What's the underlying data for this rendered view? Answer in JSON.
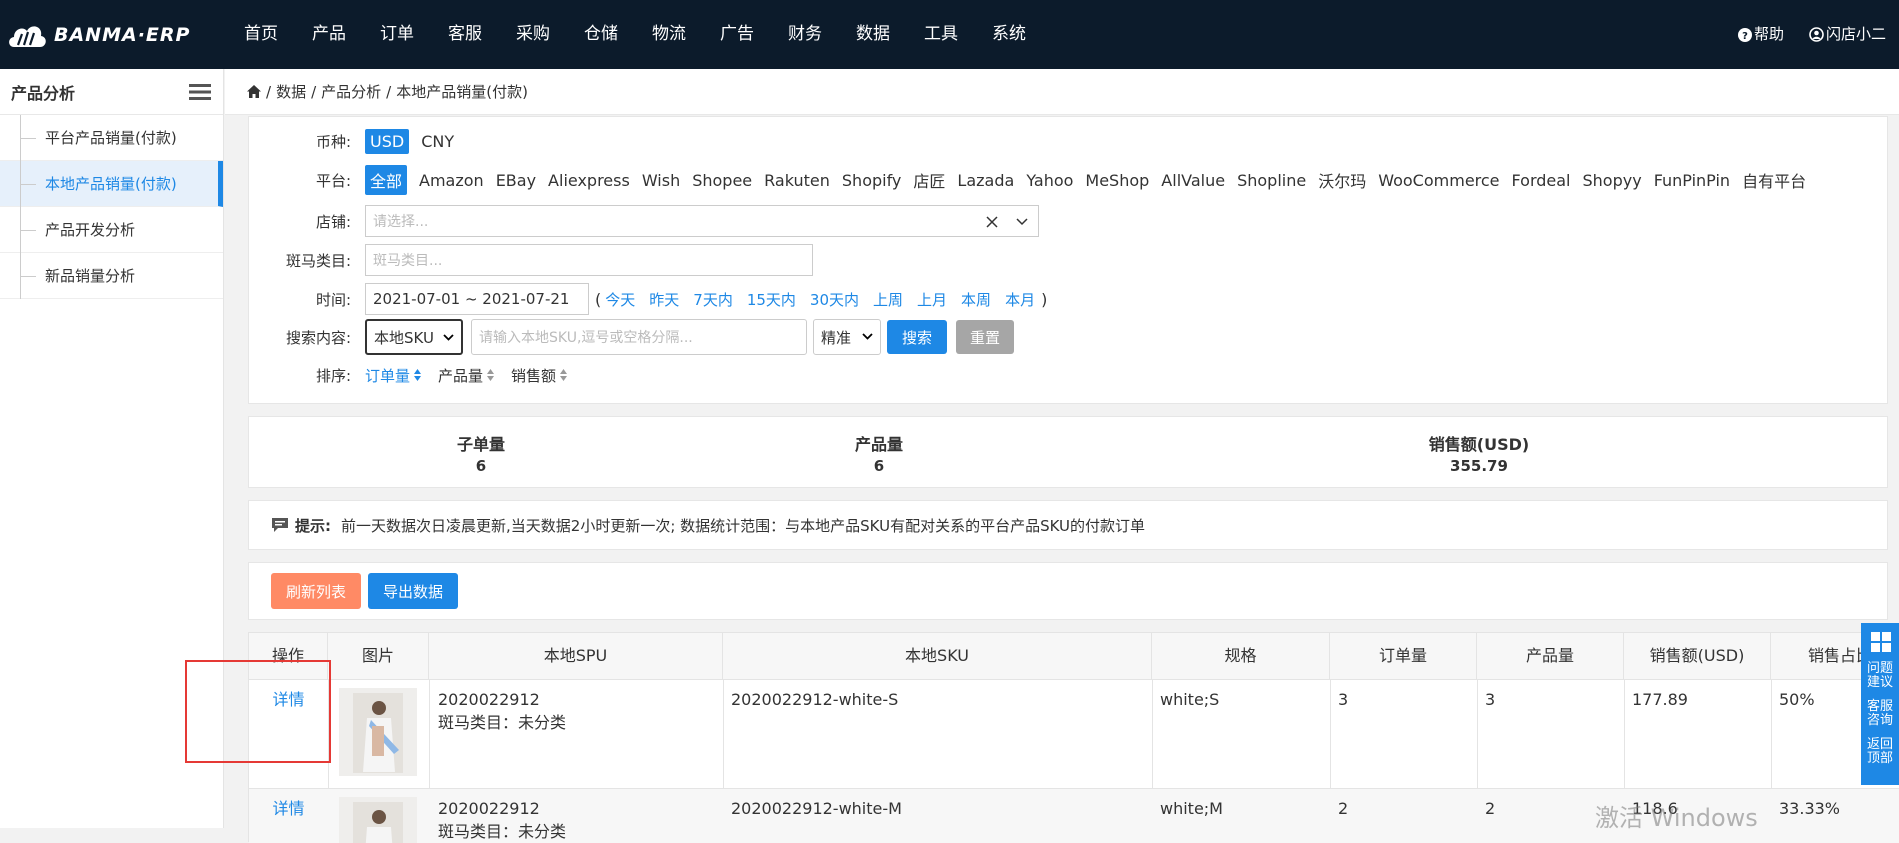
{
  "app": {
    "logo": "BANMA·ERP"
  },
  "nav": [
    "首页",
    "产品",
    "订单",
    "客服",
    "采购",
    "仓储",
    "物流",
    "广告",
    "财务",
    "数据",
    "工具",
    "系统"
  ],
  "top_right": {
    "help": "帮助",
    "user": "闪店小二"
  },
  "sidebar": {
    "title": "产品分析",
    "items": [
      {
        "label": "平台产品销量(付款)"
      },
      {
        "label": "本地产品销量(付款)"
      },
      {
        "label": "产品开发分析"
      },
      {
        "label": "新品销量分析"
      }
    ]
  },
  "breadcrumb": [
    "数据",
    "产品分析",
    "本地产品销量(付款)"
  ],
  "filters": {
    "currency": {
      "label": "币种:",
      "options": [
        "USD",
        "CNY"
      ],
      "selected": "USD"
    },
    "platform": {
      "label": "平台:",
      "options": [
        "全部",
        "Amazon",
        "EBay",
        "Aliexpress",
        "Wish",
        "Shopee",
        "Rakuten",
        "Shopify",
        "店匠",
        "Lazada",
        "Yahoo",
        "MeShop",
        "AllValue",
        "Shopline",
        "沃尔玛",
        "WooCommerce",
        "Fordeal",
        "Shopyy",
        "FunPinPin",
        "自有平台"
      ],
      "selected": "全部"
    },
    "store": {
      "label": "店铺:",
      "placeholder": "请选择..."
    },
    "category": {
      "label": "斑马类目:",
      "placeholder": "斑马类目..."
    },
    "time": {
      "label": "时间:",
      "value": "2021-07-01 ~ 2021-07-21",
      "open": "(",
      "close": ")",
      "quick": [
        "今天",
        "昨天",
        "7天内",
        "15天内",
        "30天内",
        "上周",
        "上月",
        "本周",
        "本月"
      ]
    },
    "search": {
      "label": "搜索内容:",
      "field": "本地SKU",
      "placeholder": "请输入本地SKU,逗号或空格分隔...",
      "mode": "精准",
      "search_btn": "搜索",
      "reset_btn": "重置"
    },
    "sort": {
      "label": "排序:",
      "items": [
        "订单量",
        "产品量",
        "销售额"
      ]
    }
  },
  "stats": [
    {
      "label": "子单量",
      "value": "6"
    },
    {
      "label": "产品量",
      "value": "6"
    },
    {
      "label": "销售额(USD)",
      "value": "355.79"
    }
  ],
  "tip": {
    "label": "提示:",
    "text": "前一天数据次日凌晨更新,当天数据2小时更新一次; 数据统计范围：与本地产品SKU有配对关系的平台产品SKU的付款订单"
  },
  "actions": {
    "refresh": "刷新列表",
    "export": "导出数据"
  },
  "table": {
    "headers": [
      "操作",
      "图片",
      "本地SPU",
      "本地SKU",
      "规格",
      "订单量",
      "产品量",
      "销售额(USD)",
      "销售占比"
    ],
    "rows": [
      {
        "action": "详情",
        "spu": "2020022912",
        "cat": "斑马类目：未分类",
        "sku": "2020022912-white-S",
        "spec": "white;S",
        "orders": "3",
        "qty": "3",
        "sales": "177.89",
        "share": "50%"
      },
      {
        "action": "详情",
        "spu": "2020022912",
        "cat": "斑马类目：未分类",
        "sku": "2020022912-white-M",
        "spec": "white;M",
        "orders": "2",
        "qty": "2",
        "sales": "118.6",
        "share": "33.33%"
      }
    ]
  },
  "float_panel": [
    "问题建议",
    "客服咨询",
    "返回顶部"
  ],
  "watermark": "激活 Windows",
  "colors": {
    "topbar": "#0c1b2b",
    "primary": "#1e88e5",
    "refresh": "#ff8a65",
    "reset": "#a6a6a6",
    "highlight_box": "#e53935"
  }
}
